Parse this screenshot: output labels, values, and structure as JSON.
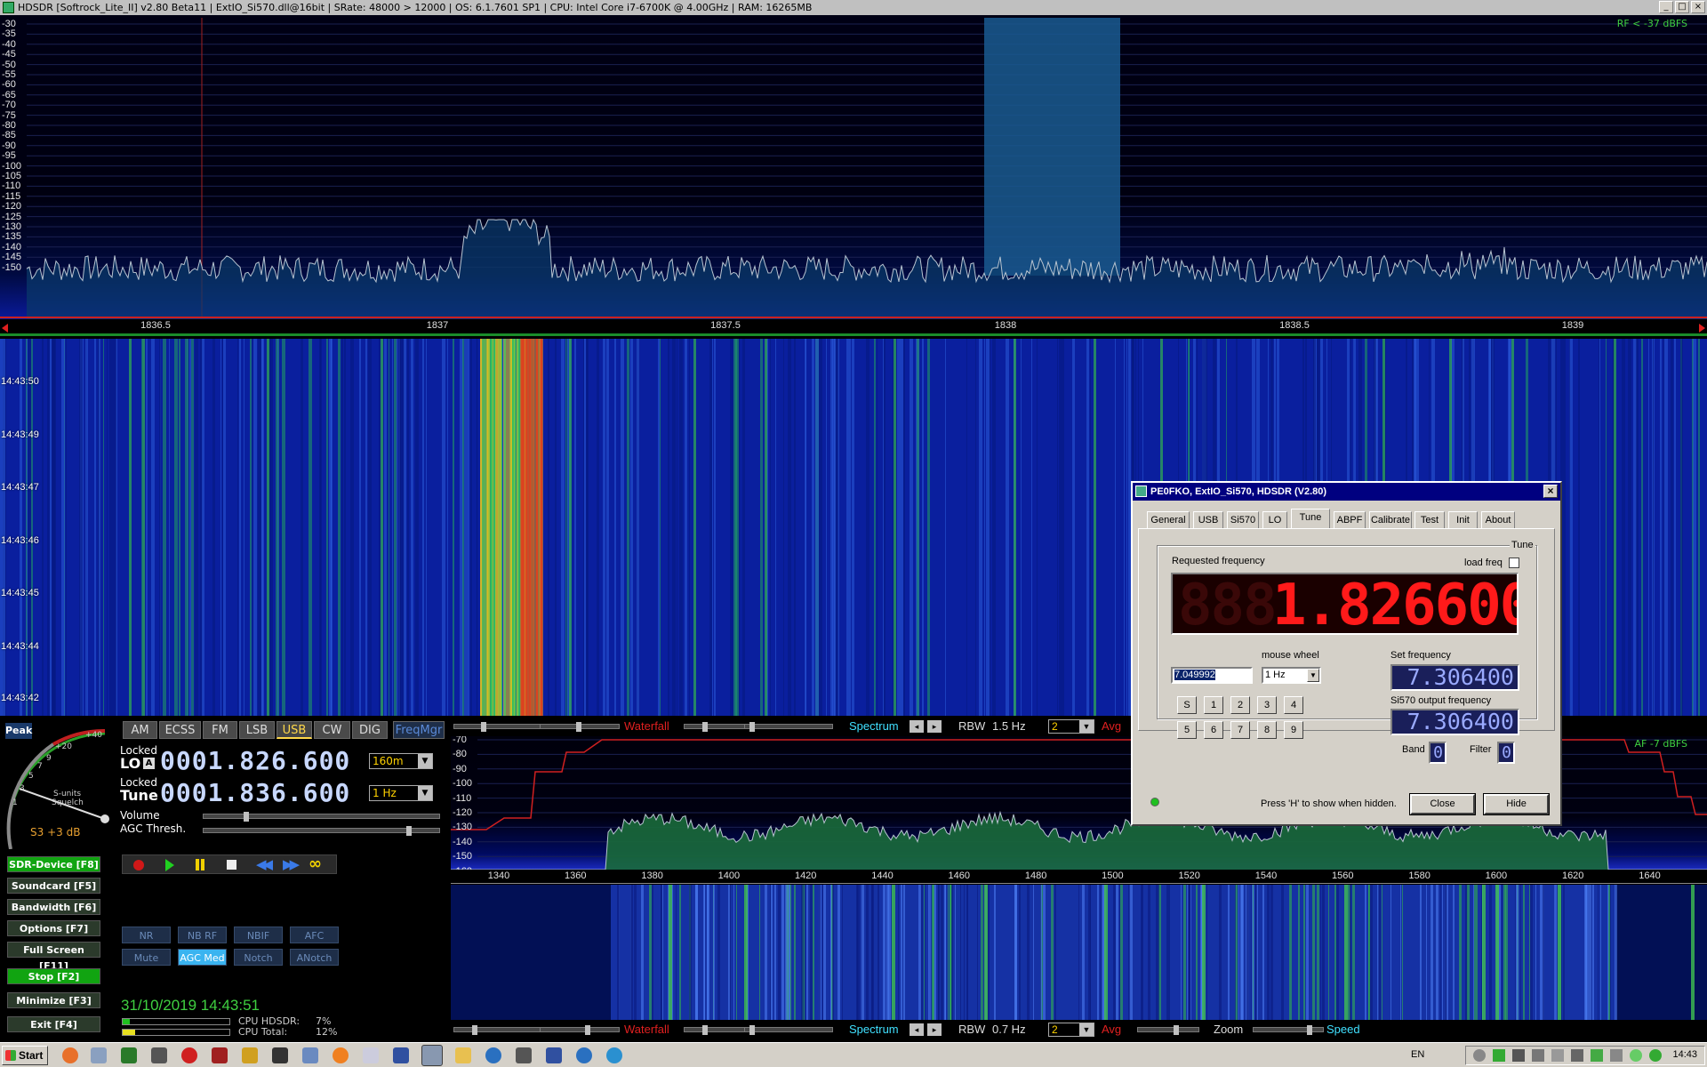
{
  "window": {
    "title": "HDSDR  [Softrock_Lite_II]  v2.80 Beta11   |  ExtIO_Si570.dll@16bit   |  SRate: 48000 > 12000   |  OS: 6.1.7601 SP1   |  CPU: Intel Core i7-6700K @ 4.00GHz   |  RAM: 16265MB",
    "btn_min": "_",
    "btn_max": "□",
    "btn_close": "×"
  },
  "rf_spectrum": {
    "level_label": "RF < -37 dBFS",
    "db_labels": [
      "-30",
      "-35",
      "-40",
      "-45",
      "-50",
      "-55",
      "-60",
      "-65",
      "-70",
      "-75",
      "-80",
      "-85",
      "-90",
      "-95",
      "-100",
      "-105",
      "-110",
      "-115",
      "-120",
      "-125",
      "-130",
      "-135",
      "-140",
      "-145",
      "-150"
    ],
    "freq_ticks": [
      "1836.5",
      "1837",
      "1837.5",
      "1838",
      "1838.5",
      "1839"
    ]
  },
  "rf_waterfall": {
    "timestamps": [
      "14:43:50",
      "14:43:49",
      "14:43:47",
      "14:43:46",
      "14:43:45",
      "14:43:44",
      "14:43:42"
    ]
  },
  "toolbar1": {
    "waterfall": "Waterfall",
    "spectrum": "Spectrum",
    "rbw_label": "RBW",
    "rbw_value": "1.5 Hz",
    "avg_value": "2",
    "avg_label": "Avg"
  },
  "toolbar2": {
    "waterfall": "Waterfall",
    "spectrum": "Spectrum",
    "rbw_label": "RBW",
    "rbw_value": "0.7 Hz",
    "avg_value": "2",
    "avg_label": "Avg",
    "zoom_label": "Zoom",
    "speed_label": "Speed"
  },
  "af_spectrum": {
    "level_label": "AF -7 dBFS",
    "db_labels": [
      "-70",
      "-80",
      "-90",
      "-100",
      "-110",
      "-120",
      "-130",
      "-140",
      "-150",
      "-160"
    ],
    "freq_ticks": [
      "1340",
      "1360",
      "1380",
      "1400",
      "1420",
      "1440",
      "1460",
      "1480",
      "1500",
      "1520",
      "1540",
      "1560",
      "1580",
      "1600",
      "1620",
      "1640"
    ]
  },
  "meter": {
    "peak": "Peak",
    "scale_marks": [
      "+20",
      "+40",
      "9",
      "7",
      "5",
      "3",
      "1"
    ],
    "s_units": "S-units",
    "squelch": "Squelch",
    "reading": "S3 +3 dB"
  },
  "modes": [
    "AM",
    "ECSS",
    "FM",
    "LSB",
    "USB",
    "CW",
    "DIG"
  ],
  "active_mode": "USB",
  "freqmgr": "FreqMgr",
  "lo": {
    "locked": "Locked",
    "label": "LO",
    "badge": "A",
    "freq": "0001.826.600",
    "band": "160m"
  },
  "tune": {
    "locked": "Locked",
    "label": "Tune",
    "freq": "0001.836.600",
    "step": "1 Hz"
  },
  "sliders": {
    "volume": "Volume",
    "agc": "AGC Thresh."
  },
  "function_buttons": [
    {
      "label": "SDR-Device  [F8]",
      "green": true
    },
    {
      "label": "Soundcard  [F5]",
      "green": false
    },
    {
      "label": "Bandwidth  [F6]",
      "green": false
    },
    {
      "label": "Options   [F7]",
      "green": false
    },
    {
      "label": "Full Screen  [F11]",
      "green": false
    },
    {
      "label": "Stop    [F2]",
      "green": true
    },
    {
      "label": "Minimize  [F3]",
      "green": false
    },
    {
      "label": "Exit    [F4]",
      "green": false
    }
  ],
  "dsp_buttons": [
    "NR",
    "NB RF",
    "NBIF",
    "AFC",
    "Mute",
    "AGC Med",
    "Notch",
    "ANotch"
  ],
  "active_dsp": "AGC Med",
  "status": {
    "datetime": "31/10/2019 14:43:51",
    "cpu_hdsdr_label": "CPU HDSDR:",
    "cpu_hdsdr": "7%",
    "cpu_total_label": "CPU Total:",
    "cpu_total": "12%",
    "cpu_hdsdr_level": 0.07,
    "cpu_total_level": 0.12
  },
  "dialog": {
    "title": "PE0FKO, ExtIO_Si570, HDSDR (V2.80)",
    "close_glyph": "×",
    "tabs": [
      "General",
      "USB",
      "Si570",
      "LO",
      "Tune",
      "ABPF",
      "Calibrate",
      "Test",
      "Init",
      "About"
    ],
    "active_tab": "Tune",
    "group_label": "Tune",
    "requested_label": "Requested frequency",
    "load_freq": "load freq",
    "big_display": "1.826600",
    "ghost_digits": "888",
    "freq_input": "7.049992",
    "mouse_wheel_label": "mouse wheel",
    "mouse_wheel_value": "1 Hz",
    "set_freq_label": "Set frequency",
    "set_freq_value": "7.306400",
    "output_label": "Si570 output frequency",
    "output_value": "7.306400",
    "band_label": "Band",
    "band_value": "0",
    "filter_label": "Filter",
    "filter_value": "0",
    "numbers_row1": [
      "S",
      "1",
      "2",
      "3",
      "4"
    ],
    "numbers_row2": [
      "5",
      "6",
      "7",
      "8",
      "9"
    ],
    "hint": "Press 'H' to show when hidden.",
    "close_btn": "Close",
    "hide_btn": "Hide"
  },
  "taskbar": {
    "start": "Start",
    "lang": "EN",
    "clock": "14:43"
  }
}
